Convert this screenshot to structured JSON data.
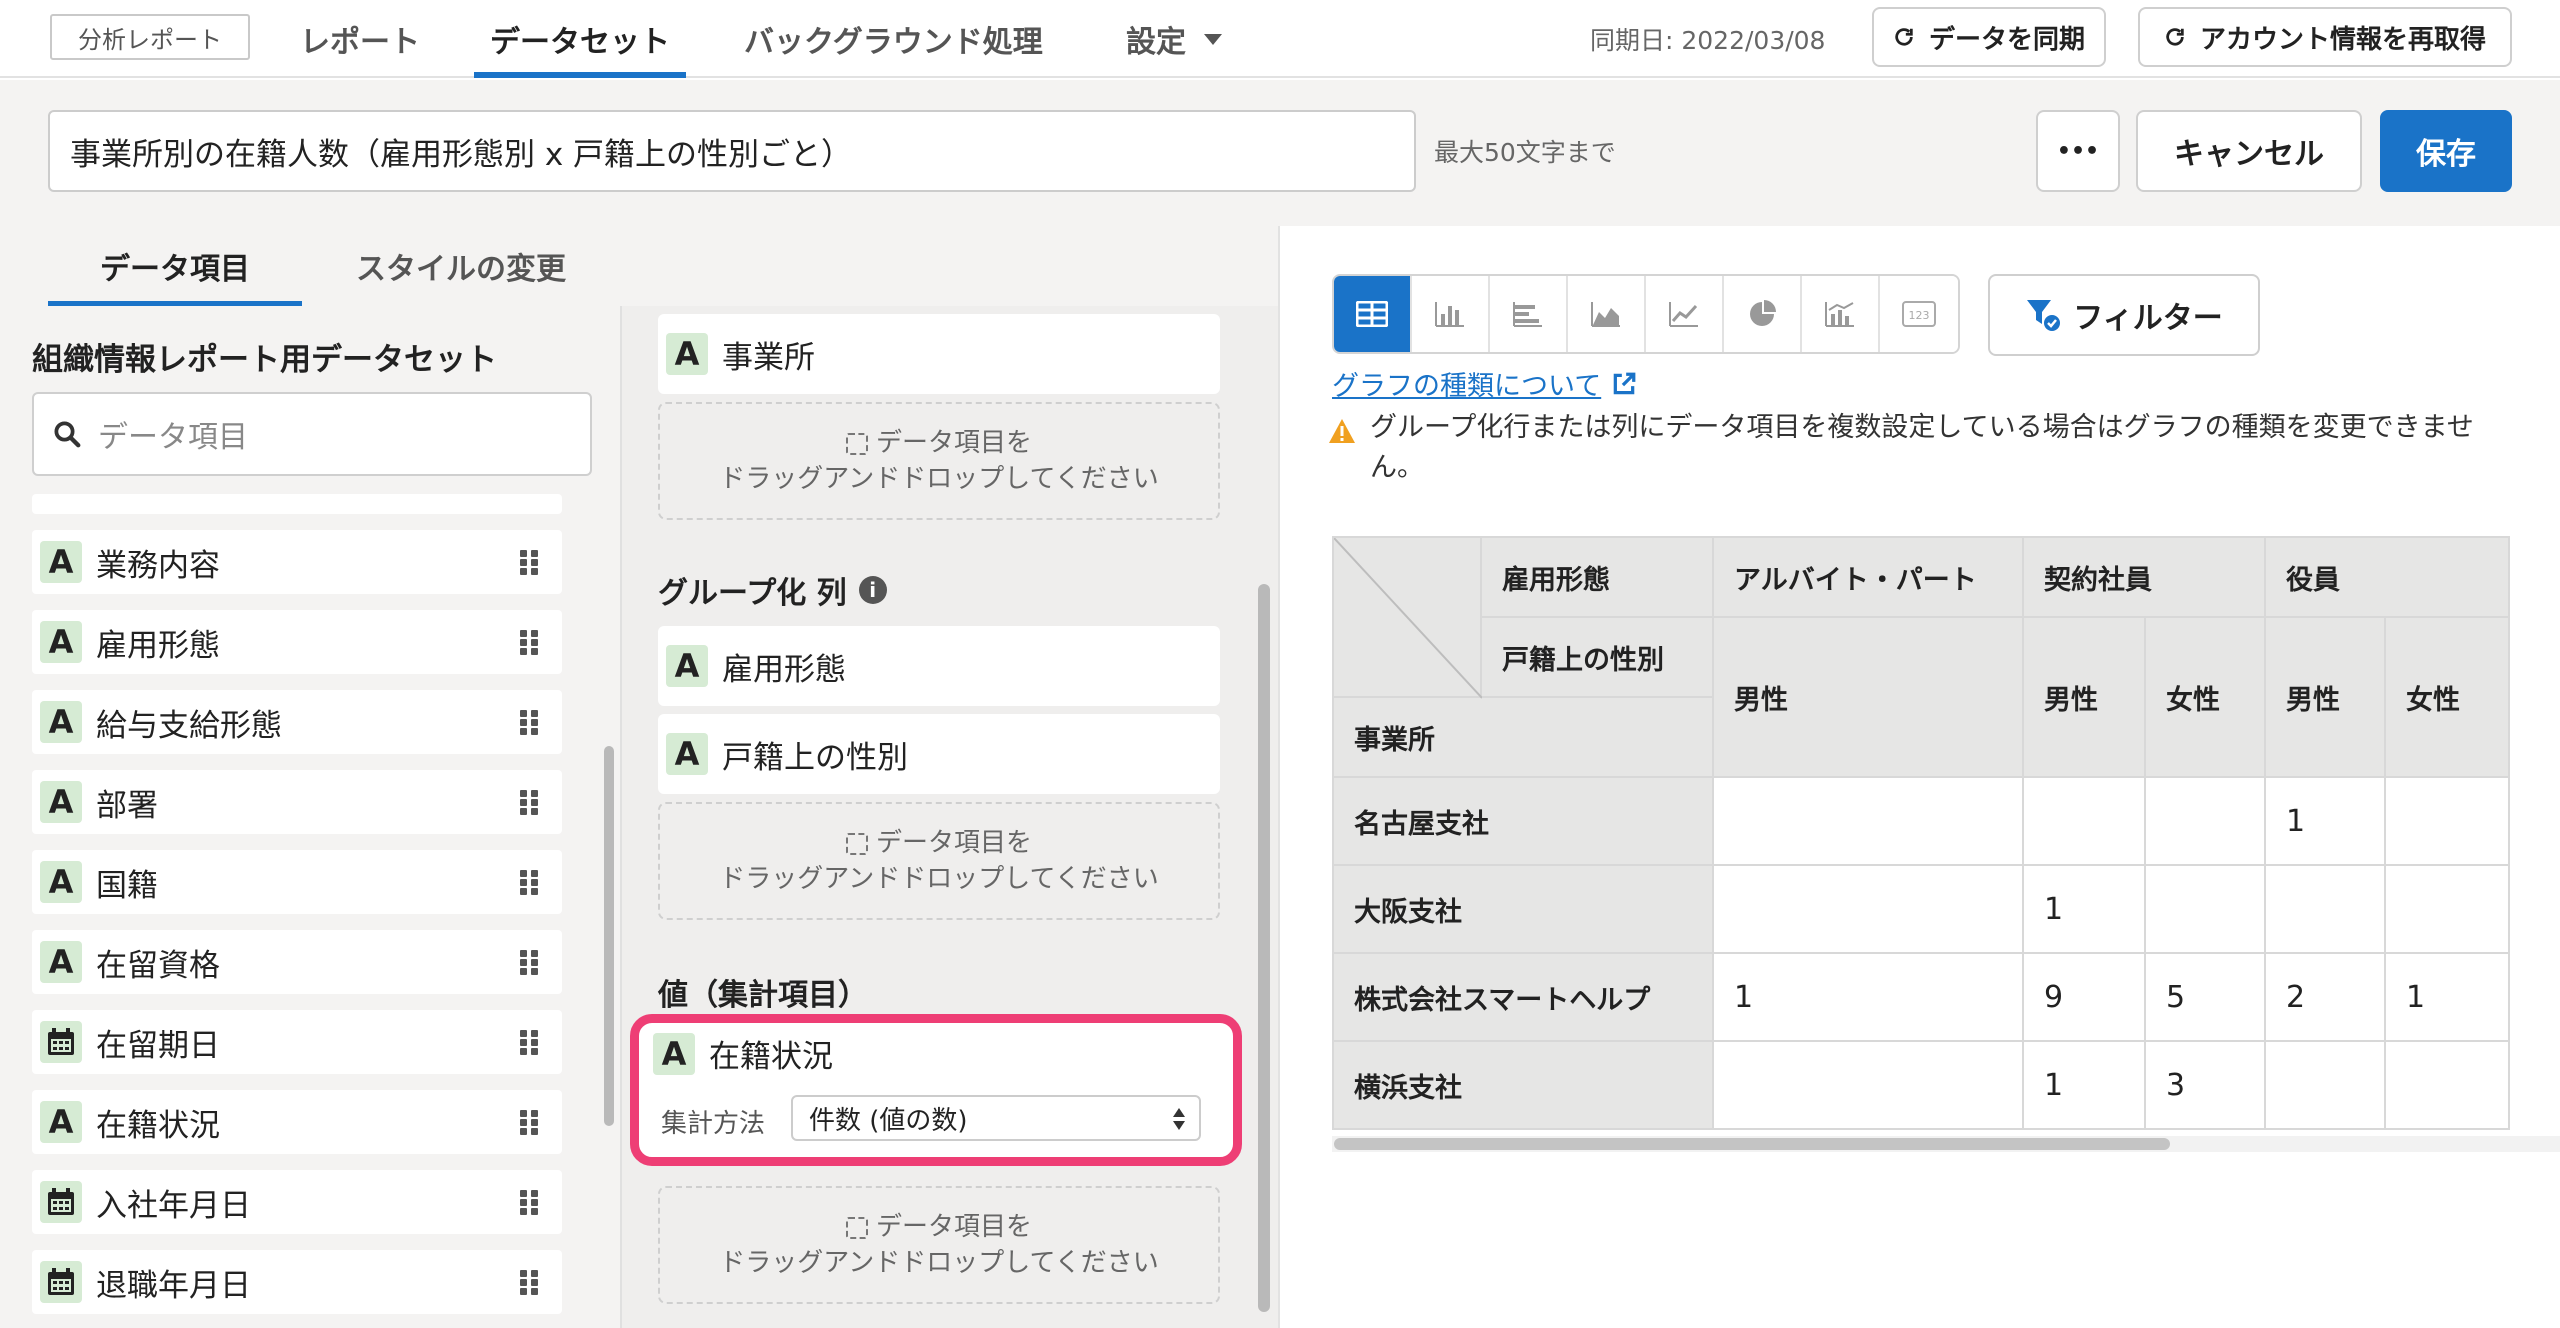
{
  "nav": {
    "brand": "分析レポート",
    "tabs": [
      "レポート",
      "データセット",
      "バックグラウンド処理",
      "設定"
    ],
    "sync_date": "同期日: 2022/03/08",
    "sync_button": "データを同期",
    "refetch_button": "アカウント情報を再取得"
  },
  "header": {
    "title_value": "事業所別の在籍人数（雇用形態別 x 戸籍上の性別ごと）",
    "max_length_hint": "最大50文字まで",
    "more_button": "•••",
    "cancel_button": "キャンセル",
    "save_button": "保存"
  },
  "left_tabs": [
    "データ項目",
    "スタイルの変更"
  ],
  "dataset": {
    "name": "組織情報レポート用データセット",
    "search_placeholder": "データ項目",
    "fields": [
      {
        "label": "業務内容",
        "type": "text",
        "badge": "A"
      },
      {
        "label": "雇用形態",
        "type": "text",
        "badge": "A"
      },
      {
        "label": "給与支給形態",
        "type": "text",
        "badge": "A"
      },
      {
        "label": "部署",
        "type": "text",
        "badge": "A"
      },
      {
        "label": "国籍",
        "type": "text",
        "badge": "A"
      },
      {
        "label": "在留資格",
        "type": "text",
        "badge": "A"
      },
      {
        "label": "在留期日",
        "type": "date",
        "badge": ""
      },
      {
        "label": "在籍状況",
        "type": "text",
        "badge": "A"
      },
      {
        "label": "入社年月日",
        "type": "date",
        "badge": ""
      },
      {
        "label": "退職年月日",
        "type": "date",
        "badge": ""
      }
    ]
  },
  "drop": {
    "row_item": "事業所",
    "dropzone_line1": "データ項目を",
    "dropzone_line2": "ドラッグアンドドロップしてください",
    "group_col_title": "グループ化 列",
    "group_col_items": [
      "雇用形態",
      "戸籍上の性別"
    ],
    "values_title": "値（集計項目）",
    "value_item": "在籍状況",
    "agg_label": "集計方法",
    "agg_value": "件数 (値の数)",
    "highlight_color": "#ee3e75"
  },
  "chart_controls": {
    "types": [
      "table-icon",
      "bar-chart-icon",
      "horizontal-bar-icon",
      "area-chart-icon",
      "line-chart-icon",
      "pie-chart-icon",
      "combo-chart-icon",
      "number-icon"
    ],
    "active": "table-icon",
    "filter_button": "フィルター",
    "link": "グラフの種類について",
    "warning": "グループ化行または列にデータ項目を複数設定している場合はグラフの種類を変更できません。"
  },
  "pivot": {
    "col_header_1": "雇用形態",
    "col_header_2": "戸籍上の性別",
    "row_header": "事業所",
    "employment_types": [
      "アルバイト・パート",
      "契約社員",
      "役員"
    ],
    "genders": [
      "男性",
      "男性",
      "女性",
      "男性",
      "女性"
    ],
    "rows": [
      {
        "name": "名古屋支社",
        "values": [
          "",
          "",
          "",
          "1",
          ""
        ]
      },
      {
        "name": "大阪支社",
        "values": [
          "",
          "1",
          "",
          "",
          ""
        ]
      },
      {
        "name": "株式会社スマートヘルプ",
        "values": [
          "1",
          "9",
          "5",
          "2",
          "1"
        ]
      },
      {
        "name": "横浜支社",
        "values": [
          "",
          "1",
          "3",
          "",
          ""
        ]
      }
    ]
  }
}
